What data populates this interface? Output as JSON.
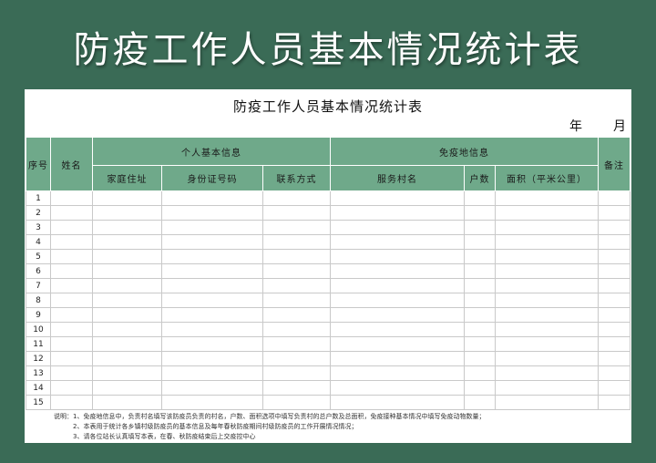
{
  "banner": {
    "title": "防疫工作人员基本情况统计表"
  },
  "sheet": {
    "title": "防疫工作人员基本情况统计表",
    "year_label": "年",
    "month_label": "月"
  },
  "table": {
    "headers": {
      "seq": "序号",
      "name": "姓名",
      "personal_group": "个人基本信息",
      "home_address": "家庭住址",
      "id_number": "身份证号码",
      "contact": "联系方式",
      "area_group": "免疫地信息",
      "village": "服务村名",
      "households": "户数",
      "area": "面积（平米公里）",
      "remarks": "备注"
    },
    "row_numbers": [
      "1",
      "2",
      "3",
      "4",
      "5",
      "6",
      "7",
      "8",
      "9",
      "10",
      "11",
      "12",
      "13",
      "14",
      "15"
    ]
  },
  "notes": {
    "line1": "说明：1、免疫地信息中，负责村名填写该防疫员负责的村名，户数、面积选项中填写负责村的总户数及总面积，免疫接种基本情况中填写免疫动物数量；",
    "line2": "2、本表用于统计各乡镇村级防疫员的基本信息及每年春秋防疫期间村级防疫员的工作开展情况情况；",
    "line3": "3、请各位站长认真填写本表，在春、秋防疫结束后上交疫控中心"
  }
}
